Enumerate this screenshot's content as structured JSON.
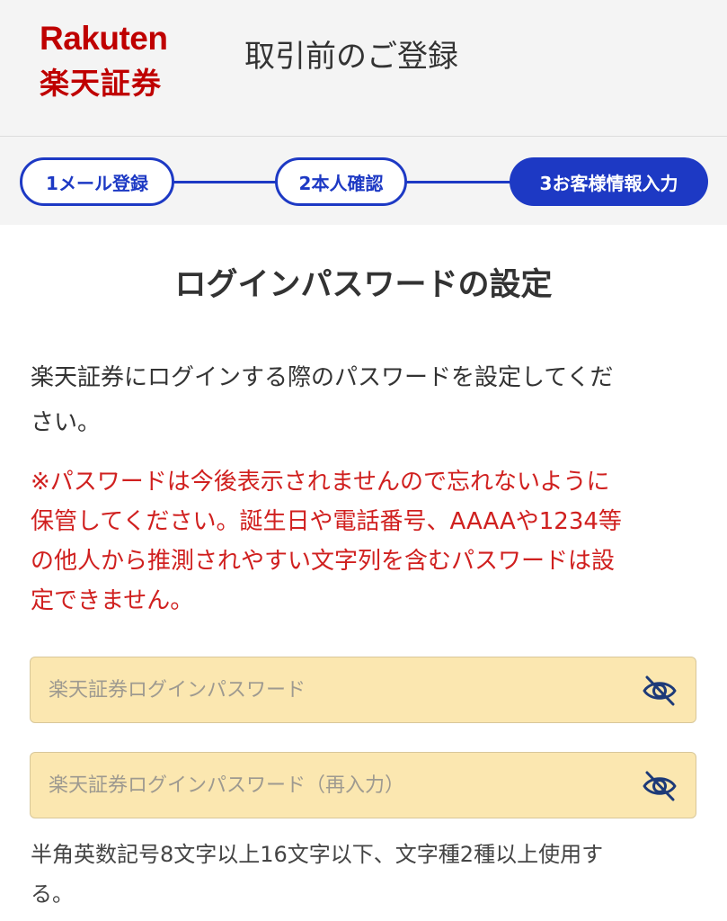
{
  "header": {
    "logo_en": "Rakuten",
    "logo_jp": "楽天証券",
    "title": "取引前のご登録"
  },
  "steps": [
    {
      "label": "1メール登録",
      "state": "done"
    },
    {
      "label": "2本人確認",
      "state": "done"
    },
    {
      "label": "3お客様情報入力",
      "state": "current"
    }
  ],
  "section": {
    "title": "ログインパスワードの設定",
    "description_line1": "楽天証券にログインする際のパスワードを設定してくだ",
    "description_line2": "さい。",
    "warning_line1": "※パスワードは今後表示されませんので忘れないように",
    "warning_line2": "保管してください。誕生日や電話番号、AAAAや1234等",
    "warning_line3": "の他人から推測されやすい文字列を含むパスワードは設",
    "warning_line4": "定できません。"
  },
  "password": {
    "placeholder": "楽天証券ログインパスワード",
    "value": "",
    "toggle_icon": "eye-slash-icon"
  },
  "password_confirm": {
    "placeholder": "楽天証券ログインパスワード（再入力）",
    "value": "",
    "toggle_icon": "eye-slash-icon"
  },
  "hint": {
    "line1": "半角英数記号8文字以上16文字以下、文字種2種以上使用す",
    "line2": "る。"
  },
  "colors": {
    "brand_red": "#bf0000",
    "step_blue": "#1d39c4",
    "warning_red": "#d0201f",
    "input_bg": "#fbe7b0"
  }
}
